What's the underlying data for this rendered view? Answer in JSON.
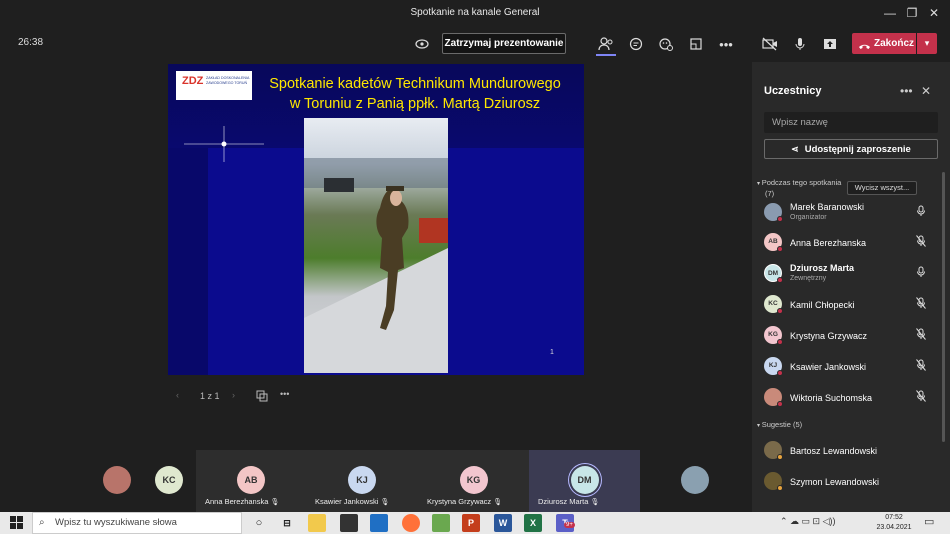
{
  "window": {
    "title": "Spotkanie na kanale General"
  },
  "toolbar": {
    "timer": "26:38",
    "stop_presenting": "Zatrzymaj prezentowanie",
    "end_call": "Zakończ"
  },
  "slide": {
    "logo_mark": "ZDZ",
    "logo_text": "ZAKŁAD DOSKONALENIA ZAWODOWEGO TORUŃ",
    "title_line1": "Spotkanie kadetów Technikum Mundurowego",
    "title_line2": "w Toruniu z Panią ppłk. Martą Dziurosz",
    "page_number": "1"
  },
  "pager": {
    "indicator": "1 z 1"
  },
  "participants_panel": {
    "title": "Uczestnicy",
    "search_placeholder": "Wpisz nazwę",
    "share_invite": "Udostępnij zaproszenie",
    "section_in_meeting_line1": "Podczas tego spotkania",
    "section_in_meeting_line2": "(7)",
    "mute_all": "Wycisz wszyst...",
    "participants": [
      {
        "name": "Marek Baranowski",
        "subtitle": "Organizator",
        "initials": "",
        "avatar_color": "#8a9bb0",
        "mic": "on",
        "photo": true
      },
      {
        "name": "Anna Berezhanska",
        "subtitle": "",
        "initials": "AB",
        "avatar_color": "#f3c6c6",
        "mic": "muted",
        "photo": false
      },
      {
        "name": "Dziurosz Marta",
        "subtitle": "Zewnętrzny",
        "initials": "DM",
        "avatar_color": "#c8e6e8",
        "mic": "on",
        "photo": false,
        "bold": true
      },
      {
        "name": "Kamil Chłopecki",
        "subtitle": "",
        "initials": "KC",
        "avatar_color": "#dfe8cf",
        "mic": "muted",
        "photo": false
      },
      {
        "name": "Krystyna Grzywacz",
        "subtitle": "",
        "initials": "KG",
        "avatar_color": "#f3c6cf",
        "mic": "muted",
        "photo": false
      },
      {
        "name": "Ksawier Jankowski",
        "subtitle": "",
        "initials": "KJ",
        "avatar_color": "#c9d8f0",
        "mic": "muted",
        "photo": false
      },
      {
        "name": "Wiktoria Suchomska",
        "subtitle": "",
        "initials": "",
        "avatar_color": "#c98a7a",
        "mic": "muted",
        "photo": true
      }
    ],
    "section_suggestions": "Sugestie (5)",
    "suggestions": [
      {
        "name": "Bartosz Lewandowski",
        "avatar_color": "#7a6a4a"
      },
      {
        "name": "Szymon Lewandowski",
        "avatar_color": "#6a5a30"
      }
    ]
  },
  "gallery": [
    {
      "name": "",
      "initials": "",
      "avatar_color": "#b8746a",
      "photo": true
    },
    {
      "name": "",
      "initials": "KC",
      "avatar_color": "#dfe8cf"
    },
    {
      "name": "Anna Berezhanska",
      "initials": "AB",
      "avatar_color": "#f3c6c6"
    },
    {
      "name": "Ksawier Jankowski",
      "initials": "KJ",
      "avatar_color": "#c9d8f0"
    },
    {
      "name": "Krystyna Grzywacz",
      "initials": "KG",
      "avatar_color": "#f3c6cf"
    },
    {
      "name": "Dziurosz Marta",
      "initials": "DM",
      "avatar_color": "#c8e6e8",
      "active": true
    },
    {
      "name": "",
      "initials": "",
      "avatar_color": "#8aa0b0",
      "photo": true
    }
  ],
  "taskbar": {
    "search_placeholder": "Wpisz tu wyszukiwane słowa",
    "time": "07:52",
    "date": "23.04.2021",
    "teams_badge": "9+"
  },
  "colors": {
    "accent": "#7f85f5",
    "end_call": "#c4314b",
    "slide_blue": "#0b0b8e",
    "title_yellow": "#ffe800"
  }
}
